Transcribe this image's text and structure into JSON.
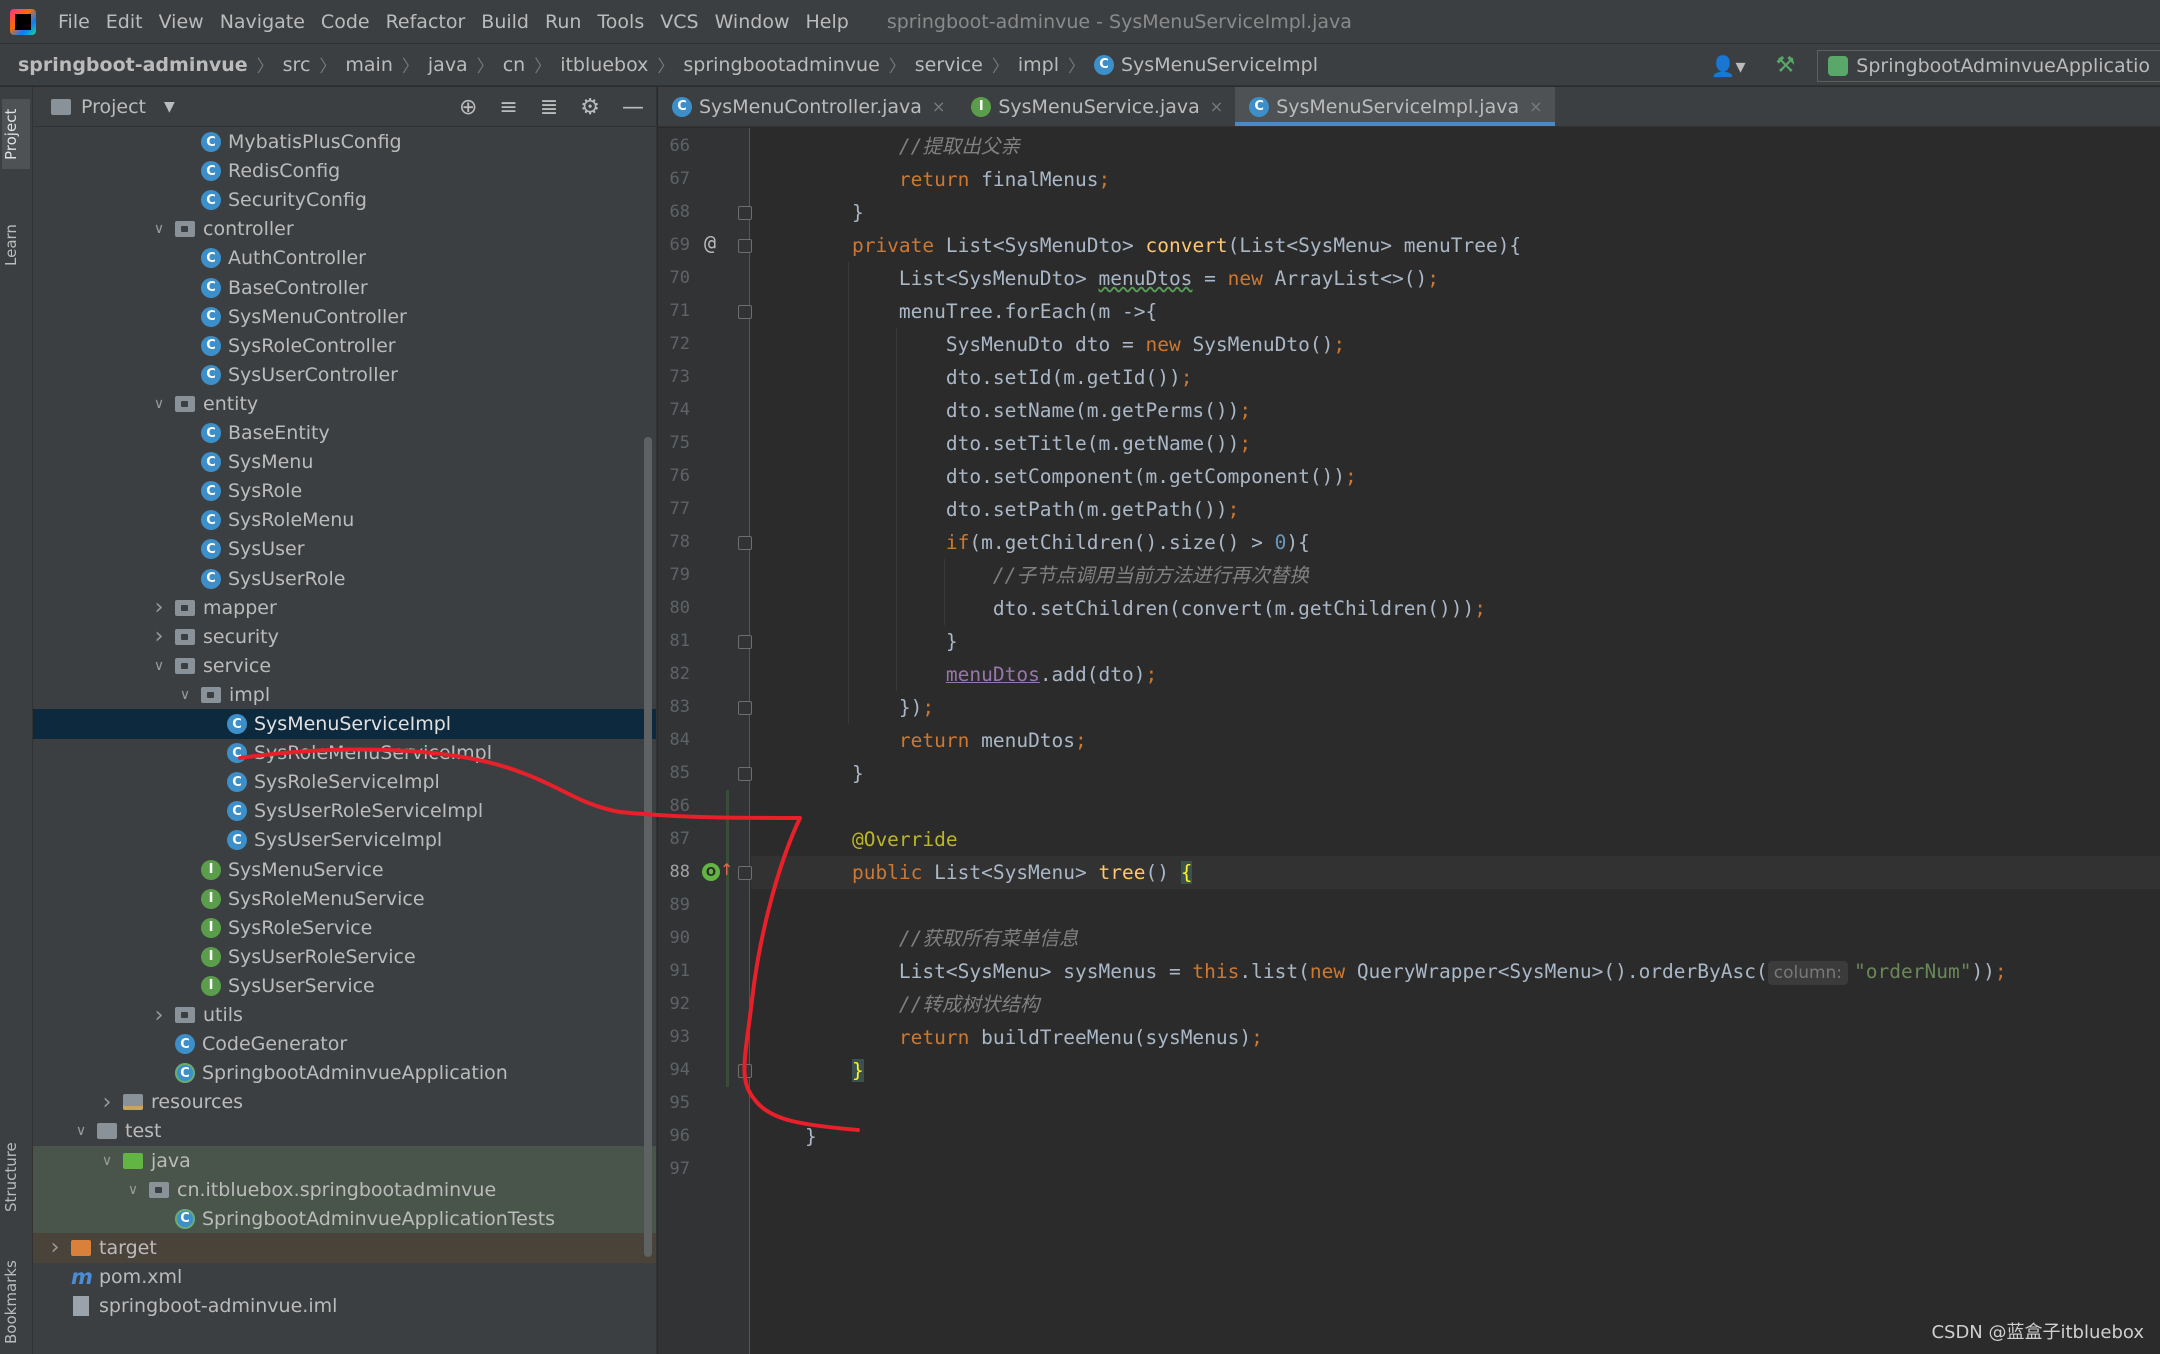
{
  "menubar": {
    "items": [
      "File",
      "Edit",
      "View",
      "Navigate",
      "Code",
      "Refactor",
      "Build",
      "Run",
      "Tools",
      "VCS",
      "Window",
      "Help"
    ],
    "window_title": "springboot-adminvue - SysMenuServiceImpl.java"
  },
  "navbar": {
    "breadcrumbs": [
      "springboot-adminvue",
      "src",
      "main",
      "java",
      "cn",
      "itbluebox",
      "springbootadminvue",
      "service",
      "impl",
      "SysMenuServiceImpl"
    ],
    "run_config": "SpringbootAdminvueApplicatio"
  },
  "toolstrip": {
    "project": "Project",
    "learn": "Learn",
    "structure": "Structure",
    "bookmarks": "Bookmarks"
  },
  "project_panel": {
    "title": "Project"
  },
  "tree": [
    {
      "label": "MybatisPlusConfig",
      "indent": 7,
      "icon": "class"
    },
    {
      "label": "RedisConfig",
      "indent": 7,
      "icon": "class"
    },
    {
      "label": "SecurityConfig",
      "indent": 7,
      "icon": "class"
    },
    {
      "label": "controller",
      "indent": 6,
      "icon": "package",
      "chev": "down"
    },
    {
      "label": "AuthController",
      "indent": 7,
      "icon": "class"
    },
    {
      "label": "BaseController",
      "indent": 7,
      "icon": "class"
    },
    {
      "label": "SysMenuController",
      "indent": 7,
      "icon": "class"
    },
    {
      "label": "SysRoleController",
      "indent": 7,
      "icon": "class"
    },
    {
      "label": "SysUserController",
      "indent": 7,
      "icon": "class"
    },
    {
      "label": "entity",
      "indent": 6,
      "icon": "package",
      "chev": "down"
    },
    {
      "label": "BaseEntity",
      "indent": 7,
      "icon": "class"
    },
    {
      "label": "SysMenu",
      "indent": 7,
      "icon": "class"
    },
    {
      "label": "SysRole",
      "indent": 7,
      "icon": "class"
    },
    {
      "label": "SysRoleMenu",
      "indent": 7,
      "icon": "class"
    },
    {
      "label": "SysUser",
      "indent": 7,
      "icon": "class"
    },
    {
      "label": "SysUserRole",
      "indent": 7,
      "icon": "class"
    },
    {
      "label": "mapper",
      "indent": 6,
      "icon": "package",
      "chev": "right"
    },
    {
      "label": "security",
      "indent": 6,
      "icon": "package",
      "chev": "right"
    },
    {
      "label": "service",
      "indent": 6,
      "icon": "package",
      "chev": "down"
    },
    {
      "label": "impl",
      "indent": 7,
      "icon": "package",
      "chev": "down"
    },
    {
      "label": "SysMenuServiceImpl",
      "indent": 8,
      "icon": "class",
      "selected": true
    },
    {
      "label": "SysRoleMenuServiceImpl",
      "indent": 8,
      "icon": "class"
    },
    {
      "label": "SysRoleServiceImpl",
      "indent": 8,
      "icon": "class"
    },
    {
      "label": "SysUserRoleServiceImpl",
      "indent": 8,
      "icon": "class"
    },
    {
      "label": "SysUserServiceImpl",
      "indent": 8,
      "icon": "class"
    },
    {
      "label": "SysMenuService",
      "indent": 7,
      "icon": "interface"
    },
    {
      "label": "SysRoleMenuService",
      "indent": 7,
      "icon": "interface"
    },
    {
      "label": "SysRoleService",
      "indent": 7,
      "icon": "interface"
    },
    {
      "label": "SysUserRoleService",
      "indent": 7,
      "icon": "interface"
    },
    {
      "label": "SysUserService",
      "indent": 7,
      "icon": "interface"
    },
    {
      "label": "utils",
      "indent": 6,
      "icon": "package",
      "chev": "right"
    },
    {
      "label": "CodeGenerator",
      "indent": 6,
      "icon": "class"
    },
    {
      "label": "SpringbootAdminvueApplication",
      "indent": 6,
      "icon": "spring"
    },
    {
      "label": "resources",
      "indent": 4,
      "icon": "resources",
      "chev": "right"
    },
    {
      "label": "test",
      "indent": 3,
      "icon": "folder",
      "chev": "down"
    },
    {
      "label": "java",
      "indent": 4,
      "icon": "green",
      "chev": "down",
      "bg": "test"
    },
    {
      "label": "cn.itbluebox.springbootadminvue",
      "indent": 5,
      "icon": "package",
      "chev": "down",
      "bg": "test"
    },
    {
      "label": "SpringbootAdminvueApplicationTests",
      "indent": 6,
      "icon": "spring",
      "bg": "test"
    },
    {
      "label": "target",
      "indent": 2,
      "icon": "orange",
      "chev": "right",
      "bg": "target"
    },
    {
      "label": "pom.xml",
      "indent": 2,
      "icon": "maven"
    },
    {
      "label": "springboot-adminvue.iml",
      "indent": 2,
      "icon": "file"
    }
  ],
  "tabs": [
    {
      "label": "SysMenuController.java",
      "icon": "class"
    },
    {
      "label": "SysMenuService.java",
      "icon": "interface"
    },
    {
      "label": "SysMenuServiceImpl.java",
      "icon": "class",
      "active": true
    }
  ],
  "editor": {
    "first_line": 66,
    "current_line": 88,
    "lines": [
      [
        [
          "cmt",
          "        //提取出父亲"
        ]
      ],
      [
        [
          "kw",
          "        return "
        ],
        [
          "",
          "finalMenus"
        ],
        [
          "kw",
          ";"
        ]
      ],
      [
        [
          "",
          "    }"
        ]
      ],
      [
        [
          "kw",
          "    private "
        ],
        [
          "",
          "List<SysMenuDto> "
        ],
        [
          "fn",
          "convert"
        ],
        [
          "",
          "(List<SysMenu> menuTree){"
        ]
      ],
      [
        [
          "",
          "        List<SysMenuDto> "
        ],
        [
          "squig",
          "menuDtos"
        ],
        [
          "",
          " = "
        ],
        [
          "kw",
          "new "
        ],
        [
          "",
          "ArrayList<>()"
        ],
        [
          "kw",
          ";"
        ]
      ],
      [
        [
          "",
          "        menuTree.forEach(m ->{"
        ]
      ],
      [
        [
          "",
          "            SysMenuDto dto = "
        ],
        [
          "kw",
          "new "
        ],
        [
          "",
          "SysMenuDto()"
        ],
        [
          "kw",
          ";"
        ]
      ],
      [
        [
          "",
          "            dto.setId(m.getId())"
        ],
        [
          "kw",
          ";"
        ]
      ],
      [
        [
          "",
          "            dto.setName(m.getPerms())"
        ],
        [
          "kw",
          ";"
        ]
      ],
      [
        [
          "",
          "            dto.setTitle(m.getName())"
        ],
        [
          "kw",
          ";"
        ]
      ],
      [
        [
          "",
          "            dto.setComponent(m.getComponent())"
        ],
        [
          "kw",
          ";"
        ]
      ],
      [
        [
          "",
          "            dto.setPath(m.getPath())"
        ],
        [
          "kw",
          ";"
        ]
      ],
      [
        [
          "kw",
          "            if"
        ],
        [
          "",
          "(m.getChildren().size() > "
        ],
        [
          "num",
          "0"
        ],
        [
          "",
          "){"
        ]
      ],
      [
        [
          "cmt",
          "                //子节点调用当前方法进行再次替换"
        ]
      ],
      [
        [
          "",
          "                dto.setChildren(convert(m.getChildren()))"
        ],
        [
          "kw",
          ";"
        ]
      ],
      [
        [
          "",
          "            }"
        ]
      ],
      [
        [
          "",
          "            "
        ],
        [
          "fld",
          "menuDtos"
        ],
        [
          "",
          ".add(dto)"
        ],
        [
          "kw",
          ";"
        ]
      ],
      [
        [
          "",
          "        })"
        ],
        [
          "kw",
          ";"
        ]
      ],
      [
        [
          "kw",
          "        return "
        ],
        [
          "",
          "menuDtos"
        ],
        [
          "kw",
          ";"
        ]
      ],
      [
        [
          "",
          "    }"
        ]
      ],
      [
        [
          "",
          ""
        ]
      ],
      [
        [
          "ann",
          "    @Override"
        ]
      ],
      [
        [
          "kw",
          "    public "
        ],
        [
          "",
          "List<SysMenu> "
        ],
        [
          "fn",
          "tree"
        ],
        [
          "",
          "() "
        ],
        [
          "brace",
          "{"
        ]
      ],
      [
        [
          "",
          ""
        ]
      ],
      [
        [
          "cmt",
          "        //获取所有菜单信息"
        ]
      ],
      [
        [
          "",
          "        List<SysMenu> sysMenus = "
        ],
        [
          "kw",
          "this"
        ],
        [
          "",
          ".list("
        ],
        [
          "kw",
          "new "
        ],
        [
          "",
          "QueryWrapper<SysMenu>().orderByAsc("
        ],
        [
          "hint",
          "column:"
        ],
        [
          "str",
          "\"orderNum\""
        ],
        [
          "",
          "))"
        ],
        [
          "kw",
          ";"
        ]
      ],
      [
        [
          "cmt",
          "        //转成树状结构"
        ]
      ],
      [
        [
          "kw",
          "        return "
        ],
        [
          "",
          "buildTreeMenu(sysMenus)"
        ],
        [
          "kw",
          ";"
        ]
      ],
      [
        [
          "",
          "    "
        ],
        [
          "brace",
          "}"
        ]
      ],
      [
        [
          "",
          ""
        ]
      ],
      [
        [
          "",
          "}"
        ]
      ],
      [
        [
          "",
          ""
        ]
      ]
    ]
  },
  "watermark": "CSDN @蓝盒子itbluebox",
  "colors": {
    "accent": "#4a88c7",
    "annotation_red": "#e8202a",
    "selection": "#0d293e"
  }
}
